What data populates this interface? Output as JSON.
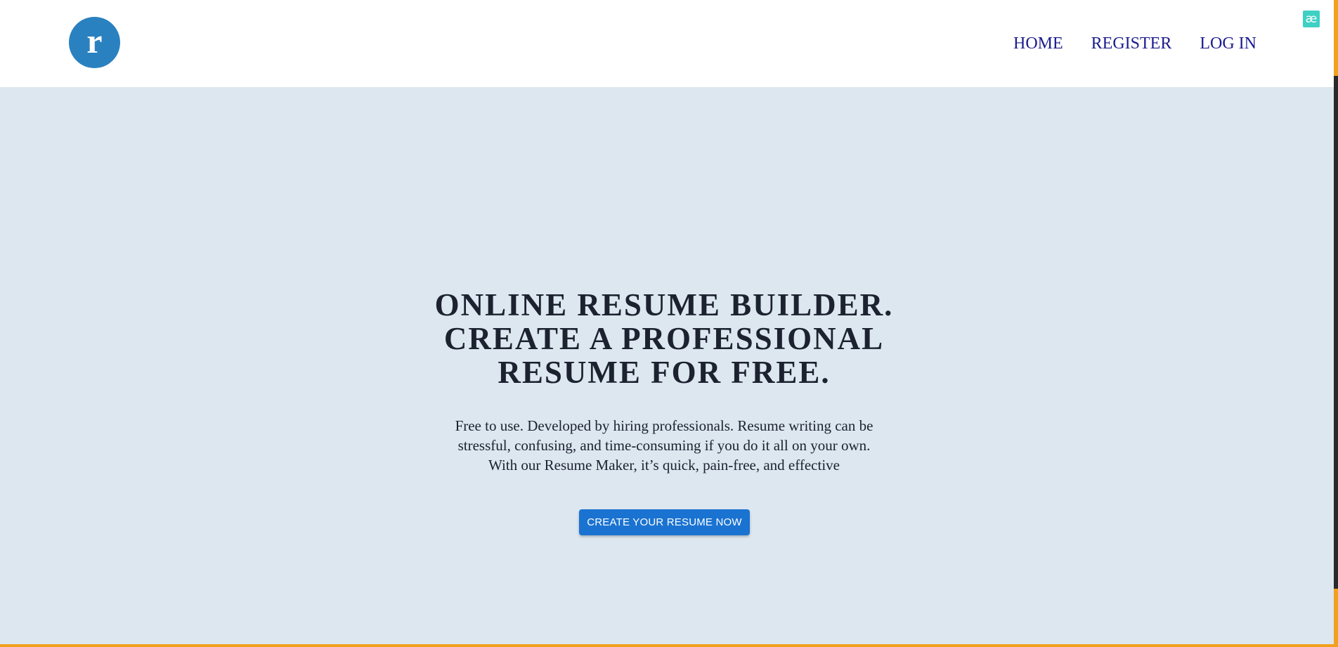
{
  "header": {
    "logo_letter": "r",
    "nav": {
      "home": "HOME",
      "register": "REGISTER",
      "login": "LOG IN"
    },
    "extension_badge": "æ"
  },
  "hero": {
    "title_lines": [
      "ONLINE RESUME BUILDER.",
      "CREATE A PROFESSIONAL",
      "RESUME FOR FREE."
    ],
    "description": "Free to use. Developed by hiring professionals. Resume writing can be stressful, confusing, and time-consuming if you do it all on your own. With our Resume Maker, it’s quick, pain-free, and effective",
    "cta_label": "CREATE YOUR RESUME NOW"
  },
  "colors": {
    "hero_background": "#dde7f0",
    "logo": "#2a81c0",
    "nav_link": "#1b1b8f",
    "cta": "#1a73d1",
    "accent_edge": "#f2a01e"
  },
  "icons": {
    "logo": "brand-logo-r",
    "extension": "extension-badge-icon"
  }
}
